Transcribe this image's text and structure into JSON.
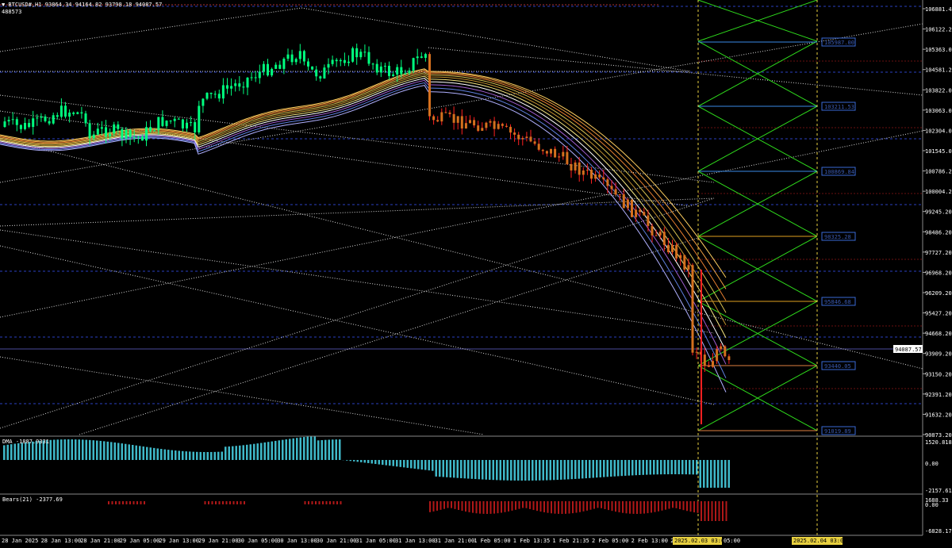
{
  "header": {
    "symbol_line": "▼ BTCUSD#,H1  93864.34 94164.82 93798.18 94087.57",
    "account": "488573"
  },
  "price_scale": [
    "106881.4",
    "106122.20",
    "105363.00",
    "104581.20",
    "103822.00",
    "103063.00",
    "102304.00",
    "101545.00",
    "100786.20",
    "100004.20",
    "99245.20",
    "98486.20",
    "97727.20",
    "96968.20",
    "96209.20",
    "95427.20",
    "94668.20",
    "93909.20",
    "93150.20",
    "92391.20",
    "91632.20",
    "90873.20"
  ],
  "current_price": "94087.57",
  "level_labels": [
    "105987.00",
    "103211.53",
    "100869.84",
    "98325.28",
    "95846.68",
    "93440.05",
    "91019.89"
  ],
  "indicators": {
    "dma": {
      "label": "DMA -1887.9331",
      "scale": [
        "1520.8189",
        "0.00",
        "-2157.6174"
      ]
    },
    "bears": {
      "label": "Bears(21) -2377.69",
      "scale": [
        "1688.33",
        "0.00",
        "-6828.17"
      ]
    }
  },
  "time_axis": [
    "28 Jan 2025",
    "28 Jan 13:00",
    "28 Jan 21:00",
    "29 Jan 05:00",
    "29 Jan 13:00",
    "29 Jan 21:00",
    "30 Jan 05:00",
    "30 Jan 13:00",
    "30 Jan 21:00",
    "31 Jan 05:00",
    "31 Jan 13:00",
    "31 Jan 21:00",
    "1 Feb 05:00",
    "1 Feb 13:35",
    "1 Feb 21:35",
    "2 Feb 05:00",
    "2 Feb 13:00",
    "2"
  ],
  "time_markers": [
    "2025.02.03 03:00",
    "05:00",
    "2025.02.04 03:00"
  ],
  "colors": {
    "background": "#000000",
    "bull": "#00ff7f",
    "bear": "#ff2020",
    "body_orange": "#d4701e",
    "grid_dash": "#2a3fbf",
    "fan_line": "#ffffff",
    "level_box": "#3a6ad6",
    "green_fan": "#2fdc1c",
    "histogram": "#3fb8c8",
    "bears_hist": "#b01818",
    "marker": "#e8d040"
  }
}
